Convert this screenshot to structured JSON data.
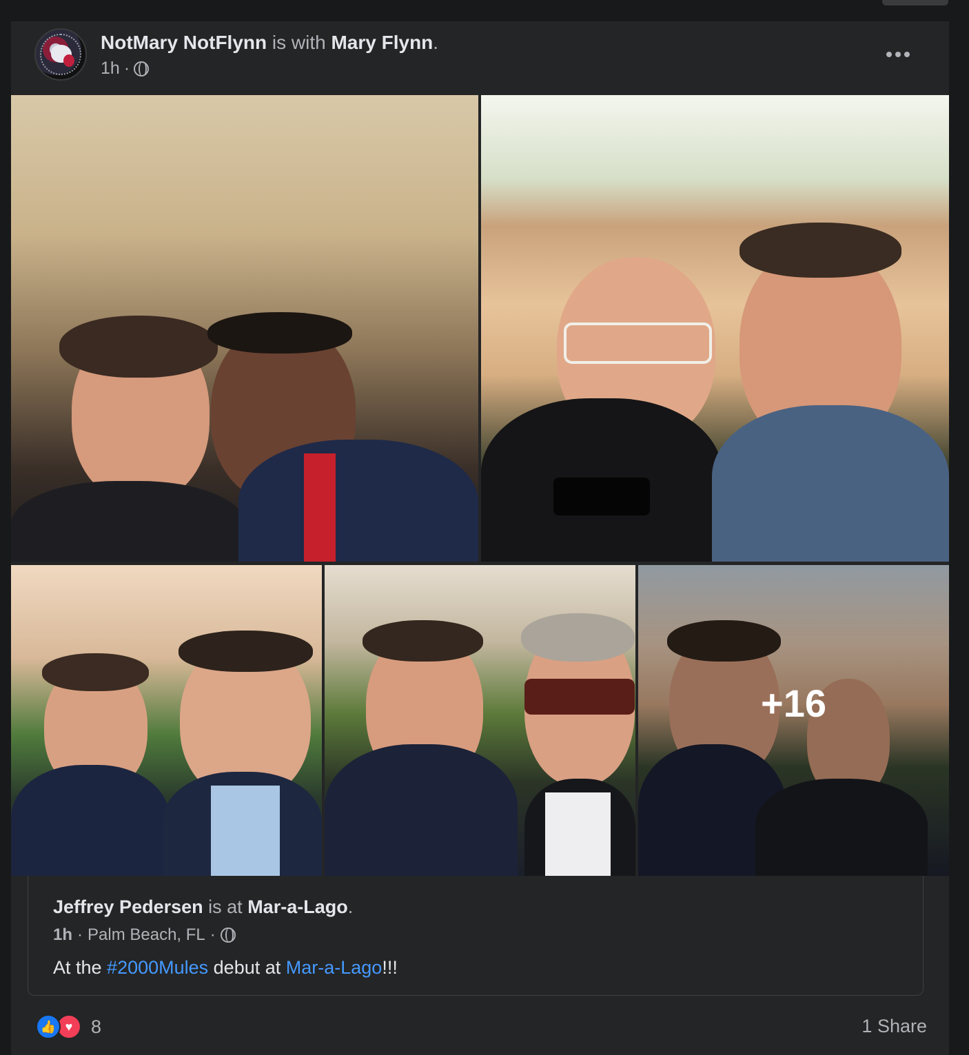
{
  "post": {
    "author": "NotMary NotFlynn",
    "with_text": "is with",
    "tagged": "Mary Flynn",
    "period": ".",
    "time": "1h",
    "dot": "·"
  },
  "photos": {
    "more_count": "+16",
    "items": [
      "photo-1",
      "photo-2",
      "photo-3",
      "photo-4",
      "photo-5"
    ]
  },
  "shared_post": {
    "author": "Jeffrey Pedersen",
    "at_text": "is at",
    "place": "Mar-a-Lago",
    "period": ".",
    "time": "1h",
    "dot": "·",
    "location": "Palm Beach, FL",
    "text_before": "At the ",
    "hashtag": "#2000Mules",
    "text_middle": " debut at ",
    "place_link": "Mar-a-Lago",
    "text_after": "!!!"
  },
  "footer": {
    "reaction_count": "8",
    "shares": "1 Share"
  },
  "colors": {
    "background": "#18191a",
    "card": "#242526",
    "primary_text": "#e4e6eb",
    "secondary_text": "#b0b3b8",
    "link": "#4599ff",
    "like": "#1877f2",
    "love": "#f33e58"
  },
  "icons": [
    "globe-icon",
    "more-options-icon",
    "like-reaction-icon",
    "love-reaction-icon"
  ]
}
